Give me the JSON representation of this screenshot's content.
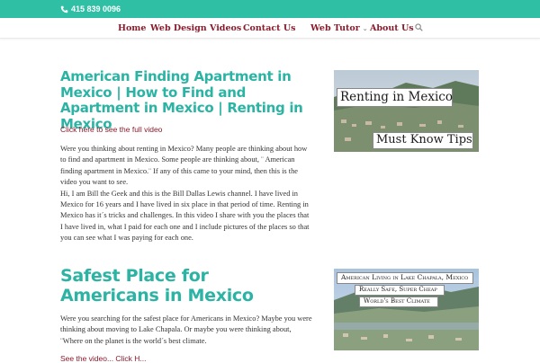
{
  "topbar": {
    "phone": "415 839 0096",
    "icon": "phone-icon",
    "color": "#2ebfa5"
  },
  "nav": {
    "items": [
      {
        "label": "Home",
        "active": true
      },
      {
        "label": "Web Design Videos",
        "has_dropdown": true
      },
      {
        "label": "Contact Us"
      },
      {
        "label": "Web Tutor",
        "has_dropdown": true
      },
      {
        "label": "About Us"
      }
    ],
    "search_icon": "search-icon",
    "link_color": "#8b1a2b"
  },
  "posts": [
    {
      "title": "American Finding Apartment in Mexico | How to Find and Apartment in Mexico | Renting in Mexico",
      "video_link": "Click here to see the full video",
      "excerpt": [
        "Were you thinking about renting in Mexico? Many people are thinking about how to find and apartment in Mexico. Some people are thinking about, ¨ American finding apartment in Mexico.¨ If any of this came to your mind, then this is the video you want to see.",
        "Hi, I am Bill the Geek and this is the Bill Dallas Lewis channel. I have lived in Mexico for 16 years and I have lived in six place in that period of time. Renting in Mexico has it´s tricks and challenges. In this video I share with you the places that I have lived in, what I paid for each one and I include pictures of the places so that you can see what I was paying for each one."
      ],
      "thumbnail": {
        "line1": "Renting in Mexico",
        "line2": "Must Know Tips"
      }
    },
    {
      "title": "Safest Place for Americans in Mexico",
      "video_link": "See the video... Click H...",
      "excerpt": [
        "Were you searching for the safest place for Americans in Mexico? Maybe you were thinking about moving to Lake Chapala. Or maybe you were thinking about, ¨Where on the planet is the world´s best climate."
      ],
      "thumbnail": {
        "line1": "American Living in Lake Chapala, Mexico",
        "line2": "Really Safe, Super Cheap",
        "line3": "World's Best Climate"
      }
    }
  ],
  "colors": {
    "title": "#2bb3a3",
    "text": "#333333"
  }
}
